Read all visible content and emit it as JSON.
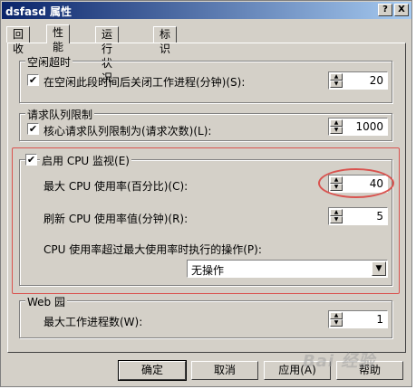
{
  "window": {
    "title": "dsfasd 属性",
    "help_btn": "?",
    "close_btn": "X"
  },
  "tabs": [
    {
      "label": "回收",
      "active": false
    },
    {
      "label": "性能",
      "active": true
    },
    {
      "label": "运行状况",
      "active": false
    },
    {
      "label": "标识",
      "active": false
    }
  ],
  "idle_timeout": {
    "legend": "空闲超时",
    "checkbox_checked": true,
    "label": "在空闲此段时间后关闭工作进程(分钟)(S):",
    "value": "20"
  },
  "queue_limit": {
    "legend": "请求队列限制",
    "checkbox_checked": true,
    "label": "核心请求队列限制为(请求次数)(L):",
    "value": "1000"
  },
  "cpu_monitor": {
    "legend": "启用 CPU 监视(E)",
    "checkbox_checked": true,
    "max_usage_label": "最大 CPU 使用率(百分比)(C):",
    "max_usage_value": "40",
    "refresh_label": "刷新 CPU 使用率值(分钟)(R):",
    "refresh_value": "5",
    "action_label": "CPU 使用率超过最大使用率时执行的操作(P):",
    "action_value": "无操作"
  },
  "web_garden": {
    "legend": "Web 园",
    "max_workers_label": "最大工作进程数(W):",
    "max_workers_value": "1"
  },
  "buttons": {
    "ok": "确定",
    "cancel": "取消",
    "apply": "应用(A)",
    "help": "帮助"
  },
  "watermark": "Bai 经验",
  "colors": {
    "title_bar": "#0a246a",
    "face": "#d4d0c8",
    "highlight_red": "#d9534f"
  }
}
